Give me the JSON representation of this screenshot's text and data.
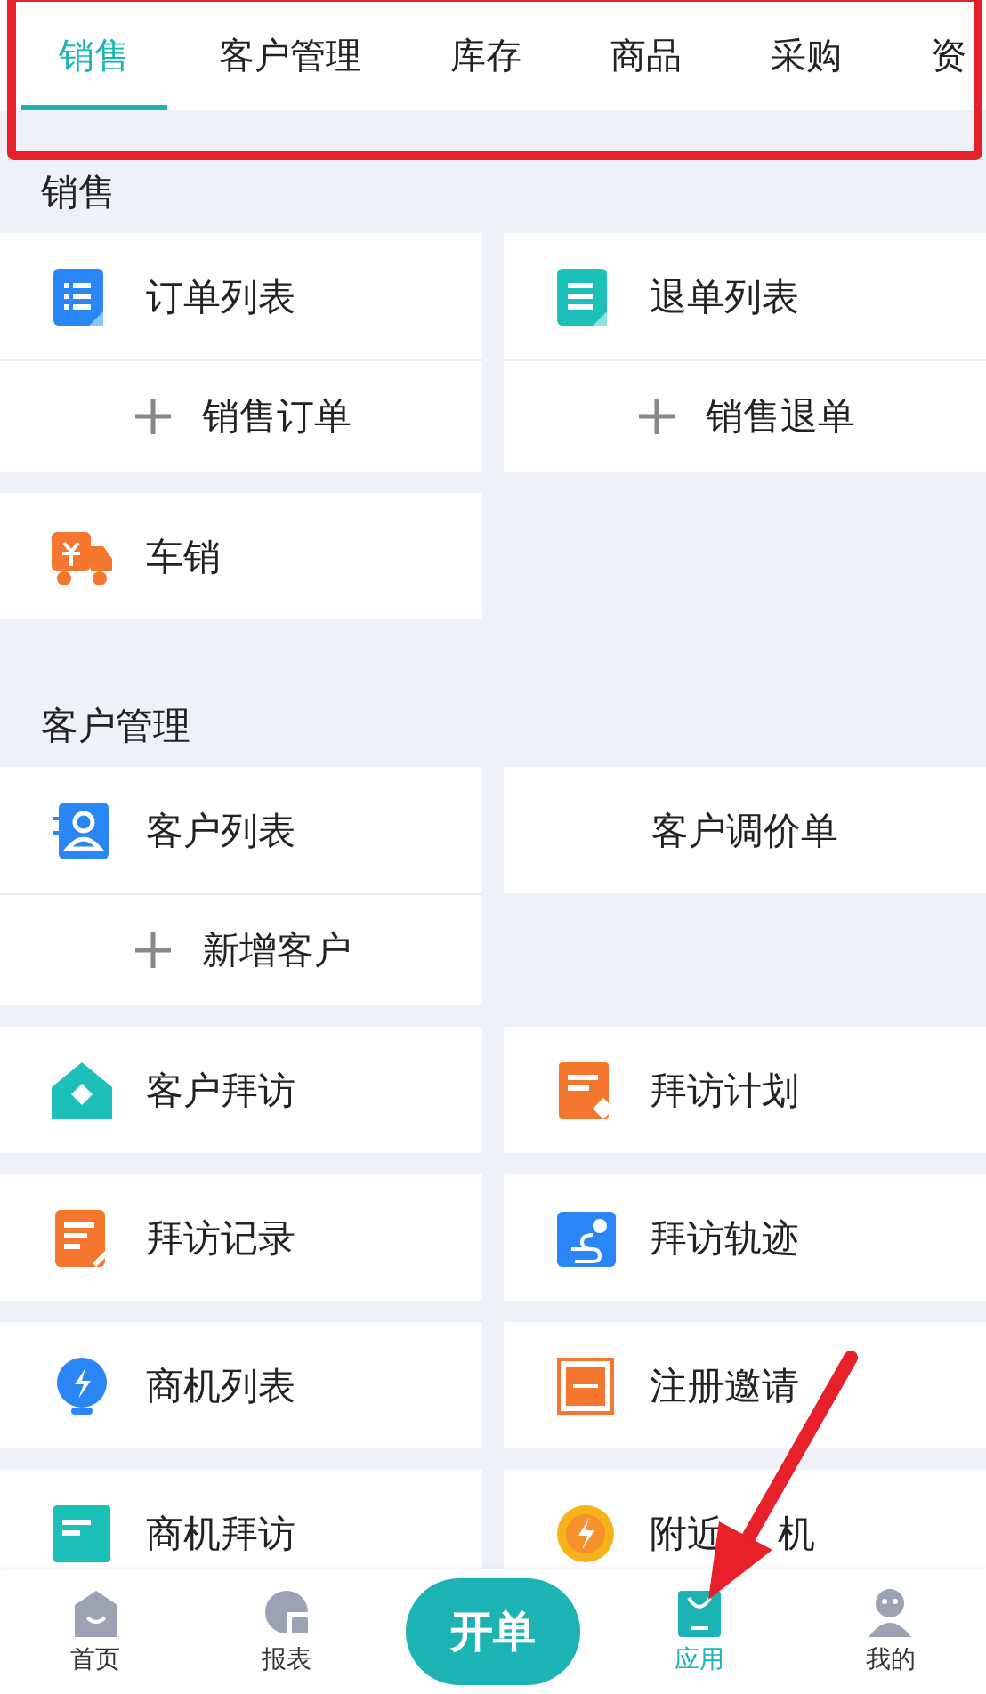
{
  "tabs": [
    {
      "label": "销售",
      "selected": true
    },
    {
      "label": "客户管理",
      "selected": false
    },
    {
      "label": "库存",
      "selected": false
    },
    {
      "label": "商品",
      "selected": false
    },
    {
      "label": "采购",
      "selected": false
    },
    {
      "label": "资",
      "selected": false
    }
  ],
  "sections": [
    {
      "title": "销售",
      "cards": [
        {
          "label": "订单列表",
          "kind": "icon",
          "action": "销售订单"
        },
        {
          "label": "退单列表",
          "kind": "icon",
          "action": "销售退单"
        },
        {
          "label": "车销",
          "kind": "icon"
        }
      ]
    },
    {
      "title": "客户管理",
      "cards": [
        {
          "label": "客户列表",
          "kind": "icon",
          "action": "新增客户"
        },
        {
          "label": "客户调价单",
          "kind": "text"
        },
        {
          "label": "客户拜访",
          "kind": "icon"
        },
        {
          "label": "拜访计划",
          "kind": "icon"
        },
        {
          "label": "拜访记录",
          "kind": "icon"
        },
        {
          "label": "拜访轨迹",
          "kind": "icon"
        },
        {
          "label": "商机列表",
          "kind": "icon"
        },
        {
          "label": "注册邀请",
          "kind": "icon"
        },
        {
          "label": "商机拜访",
          "kind": "icon"
        },
        {
          "label": "附近",
          "label_after_arrow": "机",
          "kind": "icon"
        }
      ]
    }
  ],
  "nav": [
    {
      "label": "首页",
      "kind": "tab",
      "selected": false
    },
    {
      "label": "报表",
      "kind": "tab",
      "selected": false
    },
    {
      "label": "开单",
      "kind": "button"
    },
    {
      "label": "应用",
      "kind": "tab",
      "selected": true
    },
    {
      "label": "我的",
      "kind": "tab",
      "selected": false
    }
  ]
}
